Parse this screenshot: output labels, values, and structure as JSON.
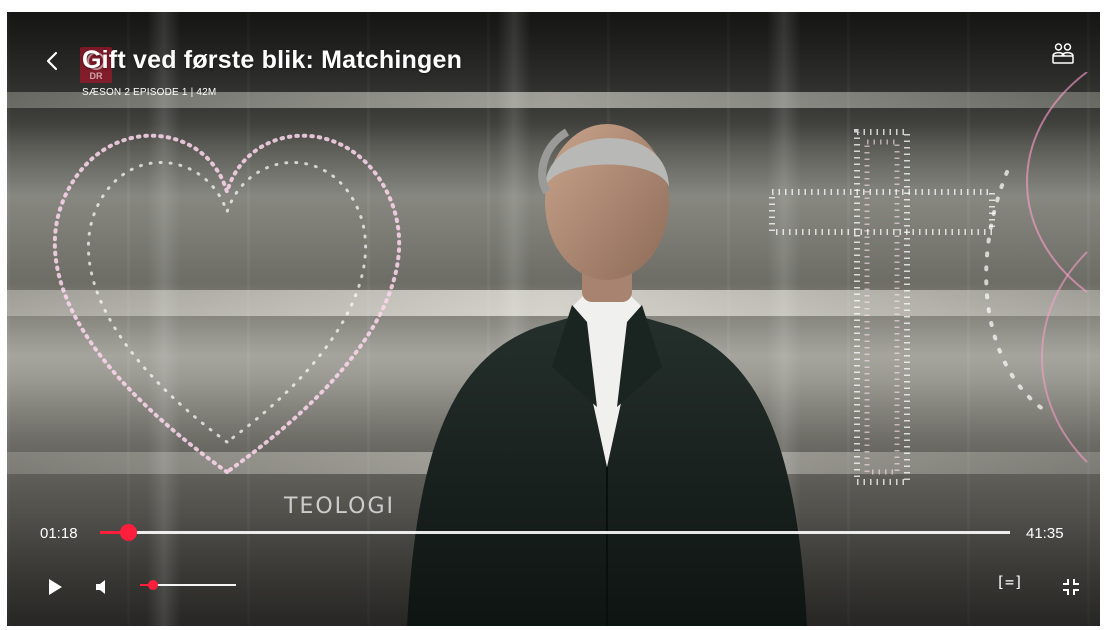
{
  "player": {
    "title": "Gift ved første blik: Matchingen",
    "subtitle": "SÆSON 2 EPISODE 1 | 42M",
    "channel": "DR",
    "overlay_caption": "TEOLOGI",
    "elapsed": "01:18",
    "total": "41:35",
    "progress_fraction": 0.031,
    "volume_fraction": 0.14,
    "subtitles_label": "[=]",
    "accent_color": "#ff1e3c",
    "icons": {
      "back": "back-chevron-icon",
      "watch_party": "watch-party-icon",
      "play": "play-icon",
      "volume": "volume-icon",
      "subtitles": "subtitles-icon",
      "exit_fullscreen": "exit-fullscreen-icon"
    }
  }
}
